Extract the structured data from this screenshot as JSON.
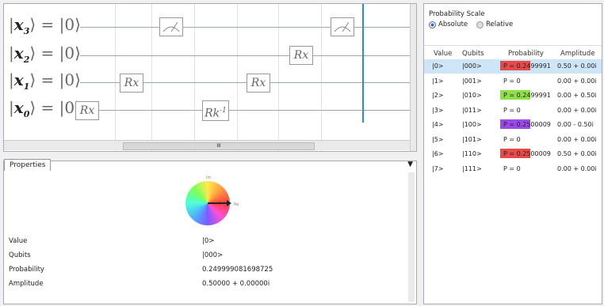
{
  "circuit": {
    "wires": [
      {
        "var": "x",
        "sub": "3",
        "ket": "|0⟩",
        "eq": "="
      },
      {
        "var": "x",
        "sub": "2",
        "ket": "|0⟩",
        "eq": "="
      },
      {
        "var": "x",
        "sub": "1",
        "ket": "|0⟩",
        "eq": "="
      },
      {
        "var": "x",
        "sub": "0",
        "ket": "|0⟩",
        "eq": "="
      }
    ],
    "gates": {
      "rx_main": "Rx",
      "rk_inv": "Rk",
      "rk_sup": "-1"
    },
    "scroll_thumb_label": "III"
  },
  "properties": {
    "tab_label": "Properties",
    "rows": [
      {
        "label": "Value",
        "value": "|0>"
      },
      {
        "label": "Qubits",
        "value": "|000>"
      },
      {
        "label": "Probability",
        "value": "0.249999081698725"
      },
      {
        "label": "Amplitude",
        "value": "0.50000 + 0.00000i"
      }
    ],
    "wheel_labels": {
      "top": "Im",
      "right": "Re"
    }
  },
  "scale": {
    "title": "Probability Scale",
    "options": [
      "Absolute",
      "Relative"
    ],
    "selected": "Absolute"
  },
  "table": {
    "headers": [
      "Value",
      "Qubits",
      "Probability",
      "Amplitude"
    ],
    "rows": [
      {
        "value": "|0>",
        "qubits": "|000>",
        "prob": "P = 0.2499991",
        "amp": "0.50 + 0.00i",
        "bar": "#e84a4a",
        "selected": true
      },
      {
        "value": "|1>",
        "qubits": "|001>",
        "prob": "P = 0",
        "amp": "0.00 + 0.00i",
        "bar": null
      },
      {
        "value": "|2>",
        "qubits": "|010>",
        "prob": "P = 0.2499991",
        "amp": "0.00 + 0.50i",
        "bar": "#8ee04a"
      },
      {
        "value": "|3>",
        "qubits": "|011>",
        "prob": "P = 0",
        "amp": "0.00 + 0.00i",
        "bar": null
      },
      {
        "value": "|4>",
        "qubits": "|100>",
        "prob": "P = 0.2500009",
        "amp": "0.00 - 0.50i",
        "bar": "#9a4ae8"
      },
      {
        "value": "|5>",
        "qubits": "|101>",
        "prob": "P = 0",
        "amp": "0.00 + 0.00i",
        "bar": null
      },
      {
        "value": "|6>",
        "qubits": "|110>",
        "prob": "P = 0.2500009",
        "amp": "0.50 + 0.00i",
        "bar": "#e84a4a"
      },
      {
        "value": "|7>",
        "qubits": "|111>",
        "prob": "P = 0",
        "amp": "0.00 + 0.00i",
        "bar": null
      }
    ]
  },
  "colors": {
    "accent": "#2a8bd8",
    "selected_row": "#cfe6f8"
  }
}
